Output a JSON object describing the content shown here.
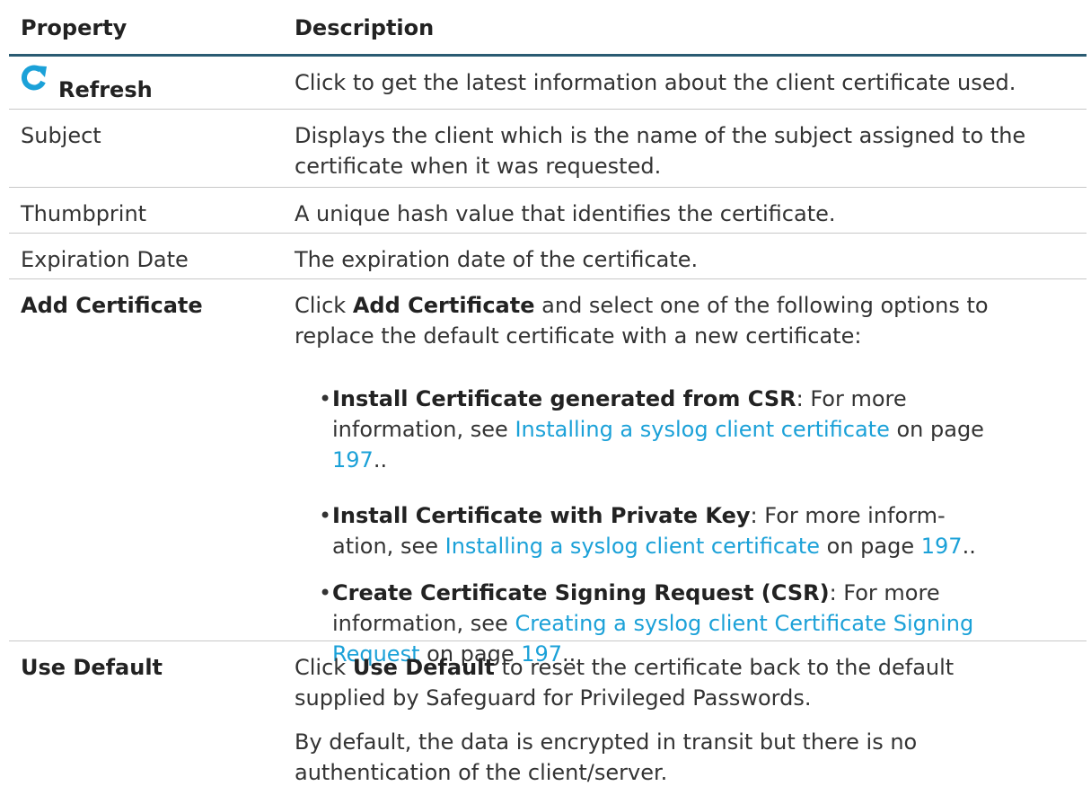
{
  "header": {
    "property": "Property",
    "description": "Description"
  },
  "rows": {
    "refresh": {
      "label": "Refresh",
      "icon": "refresh-icon",
      "description": "Click to get the latest information about the client certificate used."
    },
    "subject": {
      "label": "Subject",
      "description_l1": "Displays the client which is the name of the subject assigned to the",
      "description_l2": "certificate when it was requested."
    },
    "thumbprint": {
      "label": "Thumbprint",
      "description": "A unique hash value that identifies the certificate."
    },
    "expiration": {
      "label": "Expiration Date",
      "description": "The expiration date of the certificate."
    },
    "add_certificate": {
      "label": "Add Certificate",
      "intro_pre": "Click ",
      "intro_bold": "Add Certificate",
      "intro_post": " and select one of the following options to",
      "intro_l2": "replace the default certificate with a new certificate:",
      "options": [
        {
          "title": "Install Certificate generated from CSR",
          "l1_after": ": For more",
          "l2_pre": "information, see ",
          "l2_link": "Installing a syslog client certificate",
          "l2_post": " on page",
          "l3_link": "197",
          "l3_post": ".."
        },
        {
          "title": "Install Certificate with Private Key",
          "l1_after": ": For more inform-",
          "l2_pre": "ation, see ",
          "l2_link": "Installing a syslog client certificate",
          "l2_mid": " on page ",
          "l2_page": "197",
          "l2_post": ".."
        },
        {
          "title": "Create Certificate Signing Request (CSR)",
          "l1_after": ": For more",
          "l2_pre": "information, see ",
          "l2_link": "Creating a syslog client Certificate Signing",
          "l3_link": "Request",
          "l3_mid": " on page ",
          "l3_page": "197",
          "l3_post": ".."
        }
      ]
    },
    "use_default": {
      "label": "Use Default",
      "p1_pre": "Click ",
      "p1_bold": "Use Default",
      "p1_post": " to reset the certificate back to the default",
      "p1_l2": "supplied by Safeguard for Privileged Passwords.",
      "p2_l1": "By default, the data is encrypted in transit but there is no",
      "p2_l2": "authentication of the client/server."
    }
  },
  "colors": {
    "header_rule": "#2a5b72",
    "link": "#1ba1d8",
    "icon": "#1ba1d8"
  }
}
